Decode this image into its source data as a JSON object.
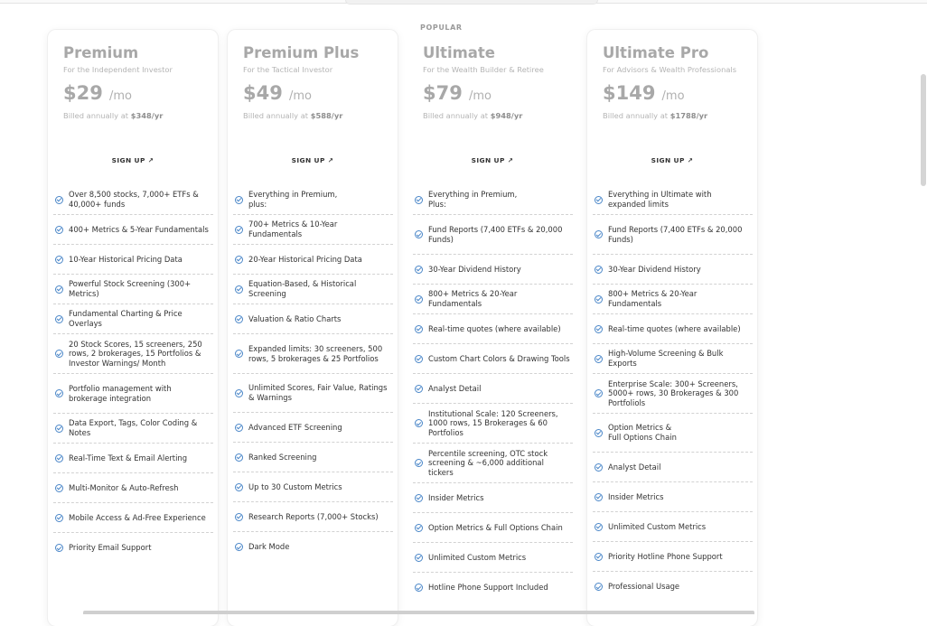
{
  "plans": [
    {
      "name": "Premium",
      "subtitle": "For the Independent Investor",
      "price": "$29",
      "per": "/mo",
      "billed_prefix": "Billed annually at ",
      "billed_amount": "$348/yr",
      "cta": "SIGN UP ↗",
      "features": [
        "Over 8,500 stocks, 7,000+ ETFs & 40,000+ funds",
        "400+ Metrics & 5-Year Fundamentals",
        "10-Year Historical Pricing Data",
        "Powerful Stock Screening (300+ Metrics)",
        "Fundamental Charting & Price Overlays",
        "20 Stock Scores, 15 screeners, 250 rows, 2 brokerages, 15 Portfolios & Investor Warnings/ Month",
        "Portfolio management with brokerage integration",
        "Data Export, Tags, Color Coding & Notes",
        "Real-Time Text & Email Alerting",
        "Multi-Monitor & Auto-Refresh",
        "Mobile Access & Ad-Free Experience",
        "Priority Email Support"
      ]
    },
    {
      "name": "Premium Plus",
      "subtitle": "For the Tactical Investor",
      "price": "$49",
      "per": "/mo",
      "billed_prefix": "Billed annually at ",
      "billed_amount": "$588/yr",
      "cta": "SIGN UP ↗",
      "features": [
        "Everything in Premium, plus:",
        "700+ Metrics & 10-Year Fundamentals",
        "20-Year Historical Pricing Data",
        "Equation-Based, & Historical Screening",
        "Valuation & Ratio Charts",
        "Expanded limits: 30 screeners, 500 rows, 5 brokerages & 25 Portfolios",
        "Unlimited Scores, Fair Value, Ratings & Warnings",
        "Advanced ETF Screening",
        "Ranked Screening",
        "Up to 30 Custom Metrics",
        "Research Reports (7,000+ Stocks)",
        "Dark Mode"
      ]
    },
    {
      "popular_label": "POPULAR",
      "name": "Ultimate",
      "subtitle": "For the Wealth Builder & Retiree",
      "price": "$79",
      "per": "/mo",
      "billed_prefix": "Billed annually at ",
      "billed_amount": "$948/yr",
      "cta": "SIGN UP ↗",
      "features": [
        "Everything in Premium, Plus:",
        "Fund Reports (7,400 ETFs & 20,000 Funds)",
        "30-Year Dividend History",
        "800+ Metrics & 20-Year Fundamentals",
        "Real-time quotes (where available)",
        "Custom Chart Colors & Drawing Tools",
        "Analyst Detail",
        "Institutional Scale: 120 Screeners, 1000 rows, 15 Brokerages & 60 Portfolios",
        "Percentile screening, OTC stock screening & ~6,000 additional tickers",
        "Insider Metrics",
        "Option Metrics & Full Options Chain",
        "Unlimited Custom Metrics",
        "Hotline Phone Support Included"
      ]
    },
    {
      "name": "Ultimate Pro",
      "subtitle": "For Advisors & Wealth Professionals",
      "price": "$149",
      "per": "/mo",
      "billed_prefix": "Billed annually at ",
      "billed_amount": "$1788/yr",
      "cta": "SIGN UP ↗",
      "features": [
        "Everything in Ultimate with expanded limits",
        "Fund Reports (7,400 ETFs & 20,000 Funds)",
        "30-Year Dividend History",
        "800+ Metrics & 20-Year Fundamentals",
        "Real-time quotes (where available)",
        "High-Volume Screening & Bulk Exports",
        "Enterprise Scale: 300+ Screeners, 5000+ rows, 30 Brokerages & 300 Portfoliols",
        "Option Metrics & Full Options Chain",
        "Analyst Detail",
        "Insider Metrics",
        "Unlimited Custom Metrics",
        "Priority Hotline Phone Support",
        "Professional Usage"
      ]
    }
  ],
  "colors": {
    "check_icon": "#4a86c8",
    "plan_title": "#a8a8a8",
    "divider": "#d2d2d2"
  }
}
